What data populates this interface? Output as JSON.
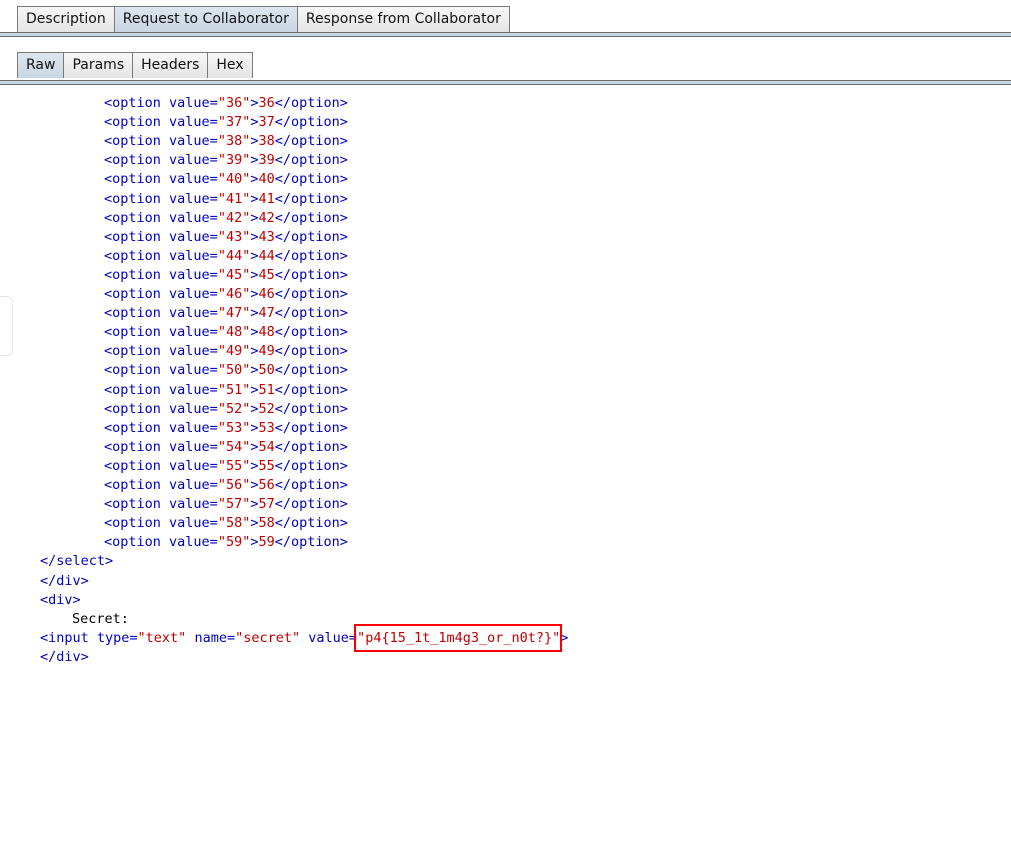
{
  "tabs": {
    "top": [
      "Description",
      "Request to Collaborator",
      "Response from Collaborator"
    ],
    "top_active": 1,
    "sub": [
      "Raw",
      "Params",
      "Headers",
      "Hex"
    ],
    "sub_active": 0
  },
  "options": [
    {
      "value": "36",
      "label": "36"
    },
    {
      "value": "37",
      "label": "37"
    },
    {
      "value": "38",
      "label": "38"
    },
    {
      "value": "39",
      "label": "39"
    },
    {
      "value": "40",
      "label": "40"
    },
    {
      "value": "41",
      "label": "41"
    },
    {
      "value": "42",
      "label": "42"
    },
    {
      "value": "43",
      "label": "43"
    },
    {
      "value": "44",
      "label": "44"
    },
    {
      "value": "45",
      "label": "45"
    },
    {
      "value": "46",
      "label": "46"
    },
    {
      "value": "47",
      "label": "47"
    },
    {
      "value": "48",
      "label": "48"
    },
    {
      "value": "49",
      "label": "49"
    },
    {
      "value": "50",
      "label": "50"
    },
    {
      "value": "51",
      "label": "51"
    },
    {
      "value": "52",
      "label": "52"
    },
    {
      "value": "53",
      "label": "53"
    },
    {
      "value": "54",
      "label": "54"
    },
    {
      "value": "55",
      "label": "55"
    },
    {
      "value": "56",
      "label": "56"
    },
    {
      "value": "57",
      "label": "57"
    },
    {
      "value": "58",
      "label": "58"
    },
    {
      "value": "59",
      "label": "59"
    }
  ],
  "tail": {
    "close_select": "</select>",
    "close_div": "</div>",
    "open_div": "<div>",
    "secret_label": "Secret:",
    "input_prefix": "<input type=\"text\" name=\"secret\" value=",
    "input_value": "\"p4{15_1t_1m4g3_or_n0t?}\"",
    "input_suffix": ">",
    "close_div2": "</div>"
  },
  "colors": {
    "tag": "#0000c0",
    "string": "#c00000",
    "highlight": "#ff0000",
    "active_tab": "#c9d6e3"
  }
}
